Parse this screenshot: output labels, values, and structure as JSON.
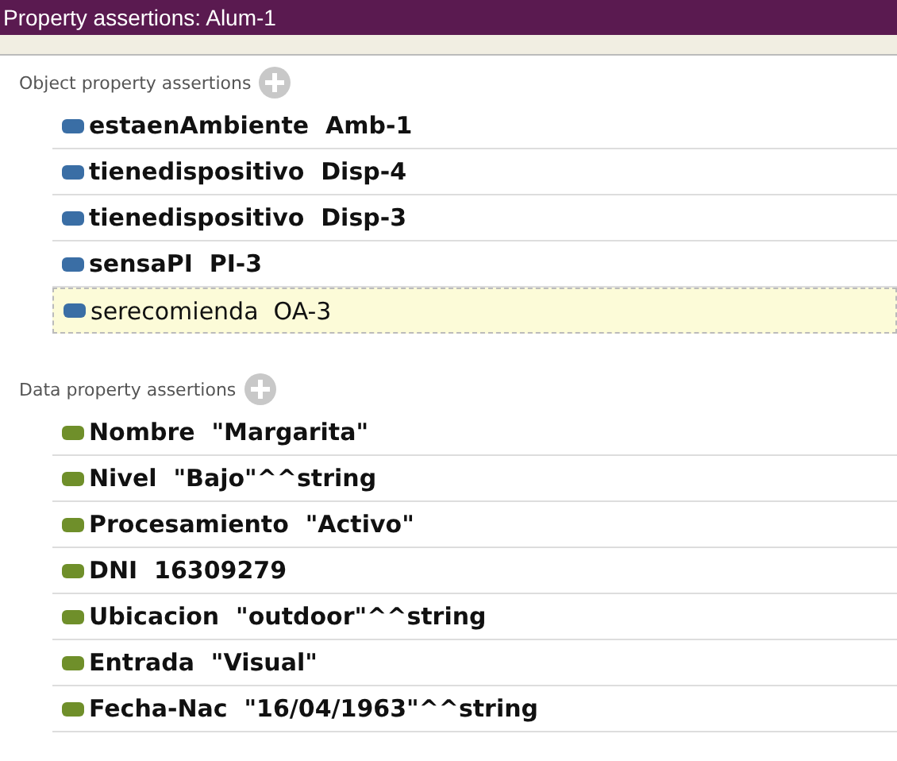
{
  "window": {
    "title": "Property assertions: Alum-1"
  },
  "sections": [
    {
      "kind": "object",
      "label": "Object property assertions",
      "items": [
        {
          "property": "estaenAmbiente",
          "value": "Amb-1",
          "selected": false
        },
        {
          "property": "tienedispositivo",
          "value": "Disp-4",
          "selected": false
        },
        {
          "property": "tienedispositivo",
          "value": "Disp-3",
          "selected": false
        },
        {
          "property": "sensaPI",
          "value": "PI-3",
          "selected": false
        },
        {
          "property": "serecomienda",
          "value": "OA-3",
          "selected": true
        }
      ]
    },
    {
      "kind": "data",
      "label": "Data property assertions",
      "items": [
        {
          "property": "Nombre",
          "value": "\"Margarita\"",
          "selected": false
        },
        {
          "property": "Nivel",
          "value": "\"Bajo\"^^string",
          "selected": false
        },
        {
          "property": "Procesamiento",
          "value": "\"Activo\"",
          "selected": false
        },
        {
          "property": "DNI",
          "value": "16309279",
          "selected": false
        },
        {
          "property": "Ubicacion",
          "value": "\"outdoor\"^^string",
          "selected": false
        },
        {
          "property": "Entrada",
          "value": "\"Visual\"",
          "selected": false
        },
        {
          "property": "Fecha-Nac",
          "value": "\"16/04/1963\"^^string",
          "selected": false
        }
      ]
    }
  ]
}
